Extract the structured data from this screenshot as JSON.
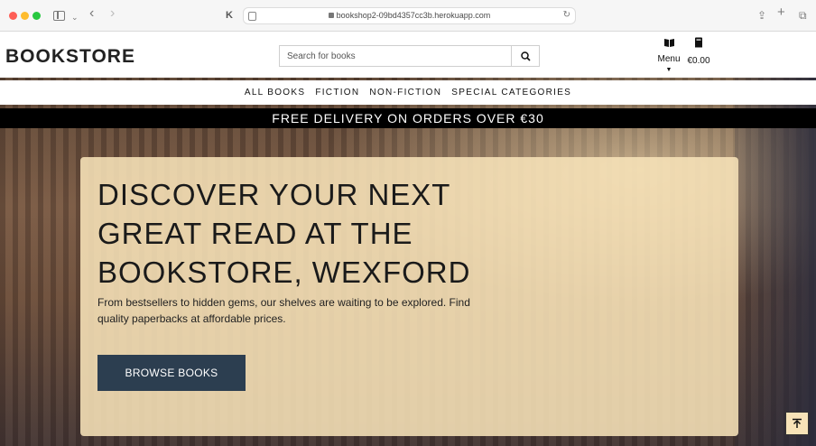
{
  "browser": {
    "url": "bookshop2-09bd4357cc3b.herokuapp.com"
  },
  "header": {
    "logo": "BOOKSTORE",
    "search_placeholder": "Search for books",
    "menu_label": "Menu",
    "basket_total": "€0.00"
  },
  "nav": {
    "items": [
      {
        "label": "ALL BOOKS"
      },
      {
        "label": "FICTION"
      },
      {
        "label": "NON-FICTION"
      },
      {
        "label": "SPECIAL CATEGORIES"
      }
    ]
  },
  "banner": {
    "text": "FREE DELIVERY ON ORDERS OVER €30"
  },
  "hero": {
    "title": "DISCOVER YOUR NEXT GREAT READ AT THE BOOKSTORE, WEXFORD",
    "subtitle": "From bestsellers to hidden gems, our shelves are waiting to be explored. Find quality paperbacks at affordable prices.",
    "button": "BROWSE BOOKS"
  },
  "colors": {
    "accent": "#2c3e50",
    "card": "#f7e3b8",
    "banner": "#000000"
  },
  "icons": {
    "search": "search-icon",
    "menu": "book-open-icon",
    "basket": "book-icon",
    "back_to_top": "arrow-up-icon"
  }
}
